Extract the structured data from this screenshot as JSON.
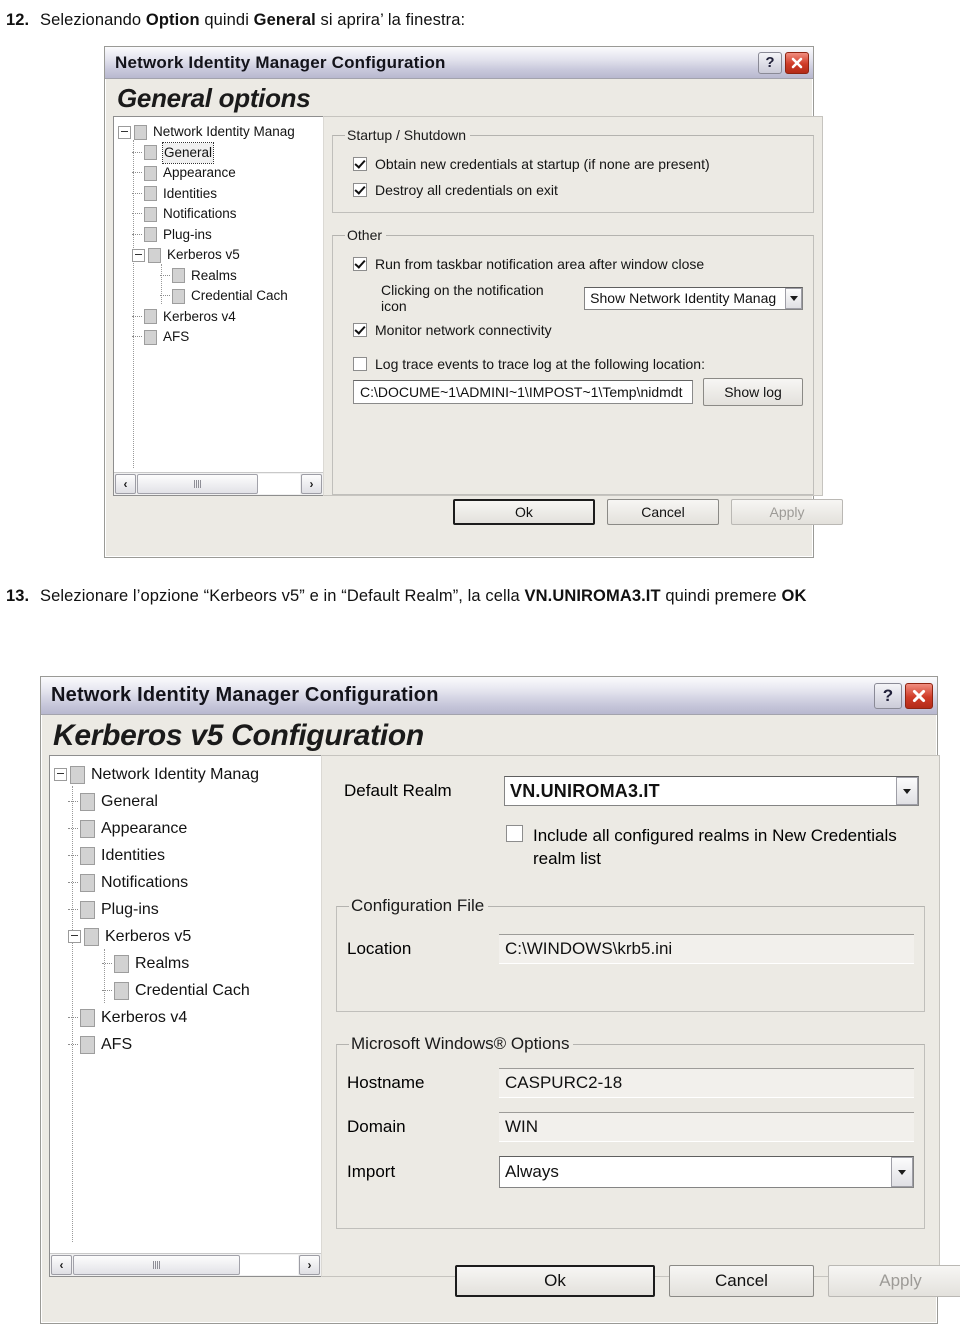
{
  "steps": {
    "step12": {
      "number": "12.",
      "text_parts": [
        "Selezionando ",
        "Option",
        " quindi ",
        "General",
        " si aprira’ la finestra:"
      ],
      "bold_1": "Option",
      "bold_2": "General",
      "plain_1": "Selezionando ",
      "plain_2": " quindi ",
      "plain_3": " si aprira’ la finestra:"
    },
    "step13": {
      "number": "13.",
      "plain_1": "Selezionare l’opzione “Kerbeors v5” e in “Default Realm”, la cella ",
      "bold_1": "VN.UNIROMA3.IT",
      "plain_2": " quindi premere ",
      "bold_2": "OK"
    }
  },
  "dialog_general": {
    "title": "Network Identity Manager Configuration",
    "help_glyph": "?",
    "heading": "General options",
    "tree": [
      {
        "label": "Network Identity Manag",
        "level": 0,
        "expander": "minus",
        "selected": false
      },
      {
        "label": "General",
        "level": 1,
        "expander": "none",
        "selected": true
      },
      {
        "label": "Appearance",
        "level": 1,
        "expander": "none",
        "selected": false
      },
      {
        "label": "Identities",
        "level": 1,
        "expander": "none",
        "selected": false
      },
      {
        "label": "Notifications",
        "level": 1,
        "expander": "none",
        "selected": false
      },
      {
        "label": "Plug-ins",
        "level": 1,
        "expander": "none",
        "selected": false
      },
      {
        "label": "Kerberos v5",
        "level": 1,
        "expander": "minus",
        "selected": false
      },
      {
        "label": "Realms",
        "level": 2,
        "expander": "none",
        "selected": false
      },
      {
        "label": "Credential Cach",
        "level": 2,
        "expander": "none",
        "selected": false
      },
      {
        "label": "Kerberos v4",
        "level": 1,
        "expander": "none",
        "selected": false
      },
      {
        "label": "AFS",
        "level": 1,
        "expander": "none",
        "selected": false
      }
    ],
    "groups": {
      "startup": {
        "legend": "Startup / Shutdown",
        "checkboxes": [
          {
            "label": "Obtain new credentials at startup (if none are present)",
            "accel": "O",
            "checked": true
          },
          {
            "label": "Destroy all credentials on exit",
            "accel": "D",
            "checked": true
          }
        ]
      },
      "other": {
        "legend": "Other",
        "check_run": {
          "label": "Run from taskbar notification area after window close",
          "accel": "R",
          "checked": true
        },
        "notification_label": "Clicking on the notification icon",
        "notification_value": "Show Network Identity Manag",
        "check_monitor": {
          "label": "Monitor network connectivity",
          "accel": "M",
          "checked": true
        },
        "check_log": {
          "label": "Log trace events to trace log at the following location:",
          "accel": "L",
          "checked": false
        },
        "log_path": "C:\\DOCUME~1\\ADMINI~1\\IMPOST~1\\Temp\\nidmdt",
        "show_log_button": "Show log"
      }
    },
    "buttons": {
      "ok": "Ok",
      "cancel": "Cancel",
      "apply": "Apply",
      "apply_disabled": true
    },
    "scrollbar": {
      "left_arrow": "‹",
      "right_arrow": "›"
    }
  },
  "dialog_kerberos": {
    "title": "Network Identity Manager Configuration",
    "help_glyph": "?",
    "heading": "Kerberos v5 Configuration",
    "tree": [
      {
        "label": "Network Identity Manag",
        "level": 0,
        "expander": "minus",
        "selected": false
      },
      {
        "label": "General",
        "level": 1,
        "expander": "none",
        "selected": false
      },
      {
        "label": "Appearance",
        "level": 1,
        "expander": "none",
        "selected": false
      },
      {
        "label": "Identities",
        "level": 1,
        "expander": "none",
        "selected": false
      },
      {
        "label": "Notifications",
        "level": 1,
        "expander": "none",
        "selected": false
      },
      {
        "label": "Plug-ins",
        "level": 1,
        "expander": "none",
        "selected": false
      },
      {
        "label": "Kerberos v5",
        "level": 1,
        "expander": "minus",
        "selected": false
      },
      {
        "label": "Realms",
        "level": 2,
        "expander": "none",
        "selected": false
      },
      {
        "label": "Credential Cach",
        "level": 2,
        "expander": "none",
        "selected": false
      },
      {
        "label": "Kerberos v4",
        "level": 1,
        "expander": "none",
        "selected": false
      },
      {
        "label": "AFS",
        "level": 1,
        "expander": "none",
        "selected": false
      }
    ],
    "default_realm_label": "Default Realm",
    "default_realm_value": "VN.UNIROMA3.IT",
    "include_realms_check": {
      "label_line1": "Include all configured realms in New Credentials",
      "label_line2": "realm list",
      "checked": false
    },
    "config_file": {
      "legend": "Configuration File",
      "location_label": "Location",
      "location_value": "C:\\WINDOWS\\krb5.ini"
    },
    "windows_options": {
      "legend": "Microsoft Windows® Options",
      "hostname_label": "Hostname",
      "hostname_value": "CASPURC2-18",
      "domain_label": "Domain",
      "domain_value": "WIN",
      "import_label": "Import",
      "import_value": "Always"
    },
    "buttons": {
      "ok": "Ok",
      "cancel": "Cancel",
      "apply": "Apply",
      "apply_disabled": true
    },
    "scrollbar": {
      "left_arrow": "‹",
      "right_arrow": "›"
    }
  },
  "colors": {
    "dialog_face": "#eceae4",
    "titlebar_top": "#fbfbfd",
    "titlebar_bottom": "#b8b8cf",
    "close_button": "#cf3c28",
    "tree_background": "#ffffff"
  }
}
